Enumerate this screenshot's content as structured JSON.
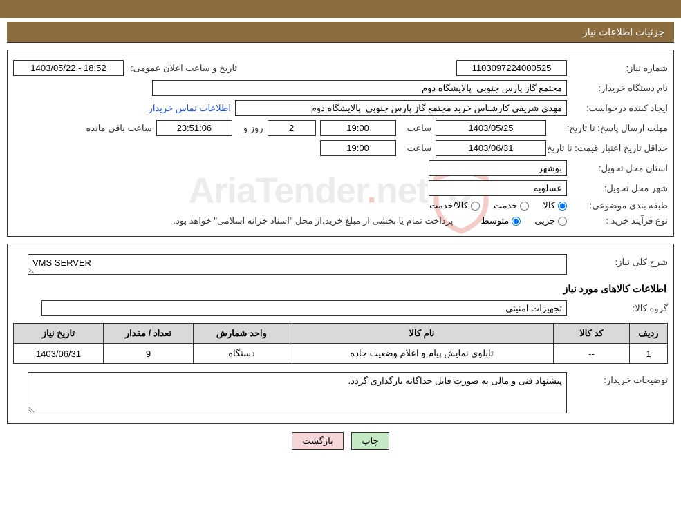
{
  "header": {
    "title": "جزئیات اطلاعات نیاز"
  },
  "labels": {
    "need_no": "شماره نیاز:",
    "public_date": "تاریخ و ساعت اعلان عمومی:",
    "buyer_org": "نام دستگاه خریدار:",
    "requester": "ایجاد کننده درخواست:",
    "contact_link": "اطلاعات تماس خریدار",
    "deadline": "مهلت ارسال پاسخ:",
    "to_date": "تا تاریخ:",
    "hour": "ساعت",
    "days_and": "روز و",
    "hours_remain": "ساعت باقی مانده",
    "price_validity": "حداقل تاریخ اعتبار قیمت:",
    "delivery_province": "استان محل تحویل:",
    "delivery_city": "شهر محل تحویل:",
    "subject_class": "طبقه بندی موضوعی:",
    "goods": "کالا",
    "service": "خدمت",
    "goods_service": "کالا/خدمت",
    "process_type": "نوع فرآیند خرید :",
    "minor": "جزیی",
    "medium": "متوسط",
    "payment_note": "پرداخت تمام یا بخشی از مبلغ خرید،از محل \"اسناد خزانه اسلامی\" خواهد بود.",
    "general_desc": "شرح کلی نیاز:",
    "items_heading": "اطلاعات کالاهای مورد نیاز",
    "goods_group": "گروه کالا:",
    "buyer_notes": "توضیحات خریدار:"
  },
  "values": {
    "need_no": "1103097224000525",
    "public_date": "1403/05/22 - 18:52",
    "buyer_org": "مجتمع گاز پارس جنوبی  پالایشگاه دوم",
    "requester": "مهدی شریفی کارشناس خرید مجتمع گاز پارس جنوبی  پالایشگاه دوم",
    "deadline_date": "1403/05/25",
    "deadline_hour": "19:00",
    "remaining_days": "2",
    "remaining_time": "23:51:06",
    "validity_date": "1403/06/31",
    "validity_hour": "19:00",
    "province": "بوشهر",
    "city": "عسلويه",
    "general_desc": "VMS SERVER",
    "goods_group": "تجهیزات امنیتی",
    "buyer_notes": "پیشنهاد فنی و مالی به صورت فایل جداگانه بارگذاری گردد."
  },
  "table": {
    "headers": {
      "row": "ردیف",
      "code": "کد کالا",
      "name": "نام کالا",
      "unit": "واحد شمارش",
      "qty": "تعداد / مقدار",
      "date": "تاریخ نیاز"
    },
    "rows": [
      {
        "row": "1",
        "code": "--",
        "name": "تابلوی نمایش پیام و اعلام وضعیت جاده",
        "unit": "دستگاه",
        "qty": "9",
        "date": "1403/06/31"
      }
    ]
  },
  "buttons": {
    "print": "چاپ",
    "back": "بازگشت"
  },
  "watermark": {
    "part1": "AriaTender",
    "dot": ".",
    "part2": "net"
  }
}
